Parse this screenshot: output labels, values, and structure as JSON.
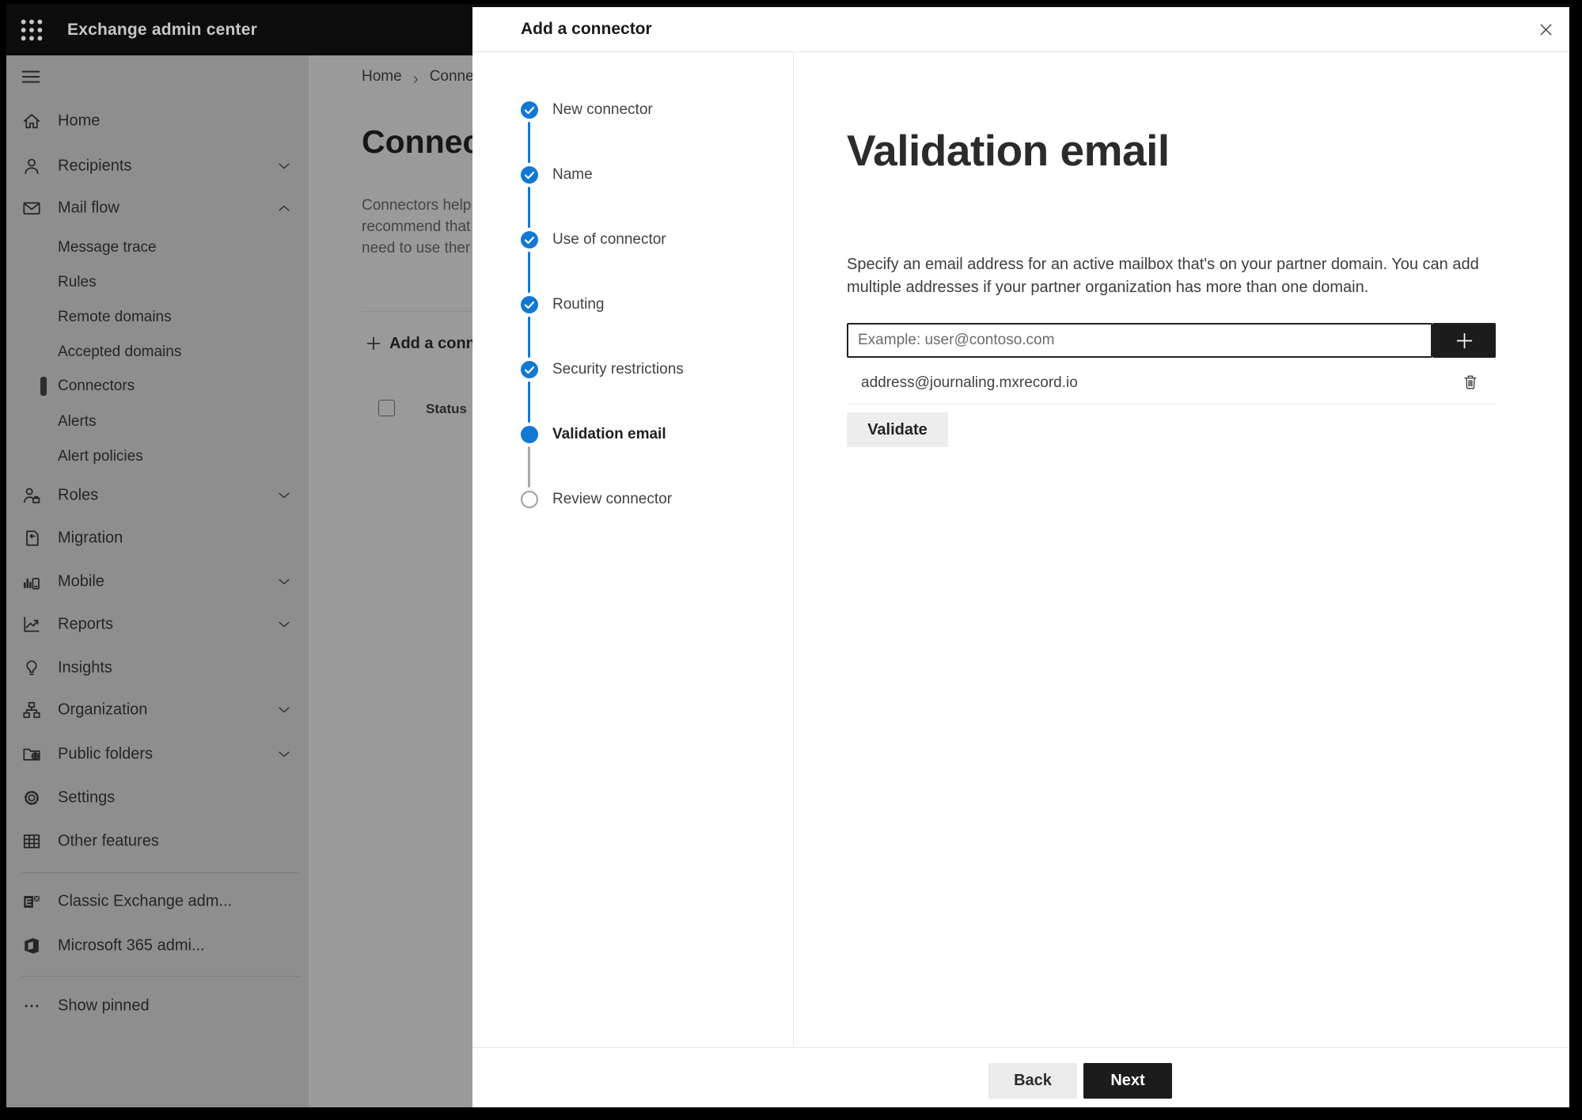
{
  "topbar": {
    "app_title": "Exchange admin center"
  },
  "sidebar": {
    "items": [
      {
        "label": "Home",
        "icon": "home",
        "type": "top"
      },
      {
        "label": "Recipients",
        "icon": "person",
        "type": "top",
        "chevron": "down"
      },
      {
        "label": "Mail flow",
        "icon": "mail",
        "type": "top",
        "chevron": "up"
      },
      {
        "label": "Message trace",
        "type": "sub"
      },
      {
        "label": "Rules",
        "type": "sub"
      },
      {
        "label": "Remote domains",
        "type": "sub"
      },
      {
        "label": "Accepted domains",
        "type": "sub"
      },
      {
        "label": "Connectors",
        "type": "sub",
        "selected": true
      },
      {
        "label": "Alerts",
        "type": "sub"
      },
      {
        "label": "Alert policies",
        "type": "sub"
      },
      {
        "label": "Roles",
        "icon": "roles",
        "type": "top",
        "chevron": "down"
      },
      {
        "label": "Migration",
        "icon": "migration",
        "type": "top"
      },
      {
        "label": "Mobile",
        "icon": "mobile",
        "type": "top",
        "chevron": "down"
      },
      {
        "label": "Reports",
        "icon": "reports",
        "type": "top",
        "chevron": "down"
      },
      {
        "label": "Insights",
        "icon": "insights",
        "type": "top"
      },
      {
        "label": "Organization",
        "icon": "organization",
        "type": "top",
        "chevron": "down"
      },
      {
        "label": "Public folders",
        "icon": "folders",
        "type": "top",
        "chevron": "down"
      },
      {
        "label": "Settings",
        "icon": "settings",
        "type": "top"
      },
      {
        "label": "Other features",
        "icon": "grid",
        "type": "top"
      },
      {
        "type": "divider"
      },
      {
        "label": "Classic Exchange adm...",
        "icon": "exchange",
        "type": "top"
      },
      {
        "label": "Microsoft 365 admi...",
        "icon": "office",
        "type": "top"
      },
      {
        "type": "divider"
      },
      {
        "label": "Show pinned",
        "icon": "ellipsis",
        "type": "top"
      }
    ]
  },
  "background_page": {
    "breadcrumb": {
      "home": "Home",
      "current": "Conne"
    },
    "title": "Connec",
    "description_lines": [
      "Connectors help",
      "recommend that",
      "need to use ther"
    ],
    "add_button_label": "Add a conn",
    "table": {
      "status_header": "Status"
    }
  },
  "modal": {
    "title": "Add a connector",
    "steps": [
      {
        "label": "New connector",
        "state": "completed"
      },
      {
        "label": "Name",
        "state": "completed"
      },
      {
        "label": "Use of connector",
        "state": "completed"
      },
      {
        "label": "Routing",
        "state": "completed"
      },
      {
        "label": "Security restrictions",
        "state": "completed"
      },
      {
        "label": "Validation email",
        "state": "current"
      },
      {
        "label": "Review connector",
        "state": "upcoming"
      }
    ],
    "content": {
      "heading": "Validation email",
      "description_lines": [
        "Specify an email address for an active mailbox that's on your partner domain. You can add",
        "multiple addresses if your partner organization has more than one domain."
      ],
      "email_input_placeholder": "Example: user@contoso.com",
      "added_addresses": [
        "address@journaling.mxrecord.io"
      ],
      "validate_button": "Validate"
    },
    "footer": {
      "back_button": "Back",
      "next_button": "Next"
    }
  },
  "colors": {
    "accent_blue": "#1179d3",
    "pending_gray": "#a8a8a8",
    "button_dark": "#1c1c1c",
    "topbar_black": "#0d0d0d"
  }
}
